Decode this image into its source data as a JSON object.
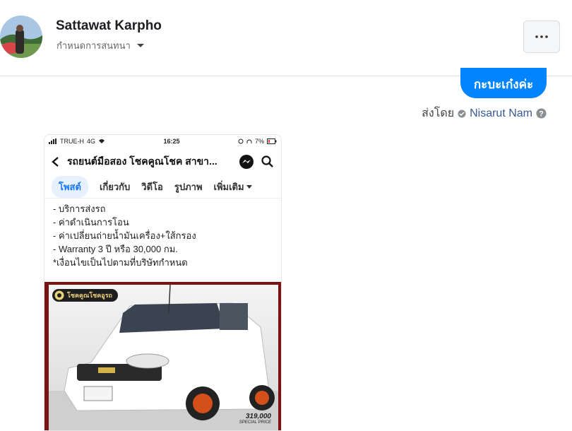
{
  "header": {
    "name": "Sattawat Karpho",
    "subtitle": "กำหนดการสนทนา",
    "more_icon": "more-dots-icon"
  },
  "message": {
    "bubble_text": "กะบะเก๋งค่ะ",
    "sent_by_label": "ส่งโดย",
    "sender": "Nisarut Nam"
  },
  "phone": {
    "carrier": "TRUE-H",
    "network": "4G",
    "time": "16:25",
    "battery": "7%",
    "page_title": "รถยนต์มือสอง โชคคูณโชค สาขา...",
    "tabs": [
      "โพสต์",
      "เกี่ยวกับ",
      "วิดีโอ",
      "รูปภาพ",
      "เพิ่มเติม"
    ],
    "post_lines": [
      "- บริการส่งรถ",
      "- ค่าดำเนินการโอน",
      "- ค่าเปลี่ยนถ่ายน้ำมันเครื่อง+ใส้กรอง",
      "- Warranty 3 ปี หรือ 30,000 กม.",
      "*เงื่อนไขเป็นไปตามที่บริษัทกำหนด"
    ],
    "badge_text": "โชคคูณโชคอูรถ",
    "price": "319,000",
    "price_label": "SPECIAL PRICE"
  },
  "colors": {
    "bubble": "#0084ff",
    "sender_link": "#385898",
    "frame": "#7a1414"
  }
}
